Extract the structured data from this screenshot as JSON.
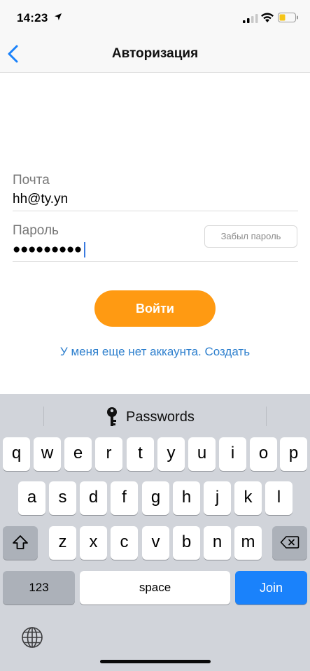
{
  "status_bar": {
    "time": "14:23",
    "icons": [
      "location-arrow-icon",
      "signal-icon",
      "wifi-icon",
      "battery-icon"
    ]
  },
  "nav": {
    "title": "Авторизация",
    "back_icon": "chevron-left-icon"
  },
  "form": {
    "email_label": "Почта",
    "email_value": "hh@ty.yn",
    "password_label": "Пароль",
    "password_masked": "●●●●●●●●●",
    "forgot_label": "Забыл пароль",
    "login_label": "Войти",
    "register_text": "У меня еще нет аккаунта. Создать"
  },
  "keyboard": {
    "passwords_label": "Passwords",
    "row1": [
      "q",
      "w",
      "e",
      "r",
      "t",
      "y",
      "u",
      "i",
      "o",
      "p"
    ],
    "row2": [
      "a",
      "s",
      "d",
      "f",
      "g",
      "h",
      "j",
      "k",
      "l"
    ],
    "row3": [
      "z",
      "x",
      "c",
      "v",
      "b",
      "n",
      "m"
    ],
    "numbers_label": "123",
    "space_label": "space",
    "join_label": "Join"
  },
  "colors": {
    "accent_orange": "#ff9a12",
    "link_blue": "#2f80ce",
    "ios_blue": "#1a82fb",
    "keyboard_bg": "#d1d4da"
  }
}
